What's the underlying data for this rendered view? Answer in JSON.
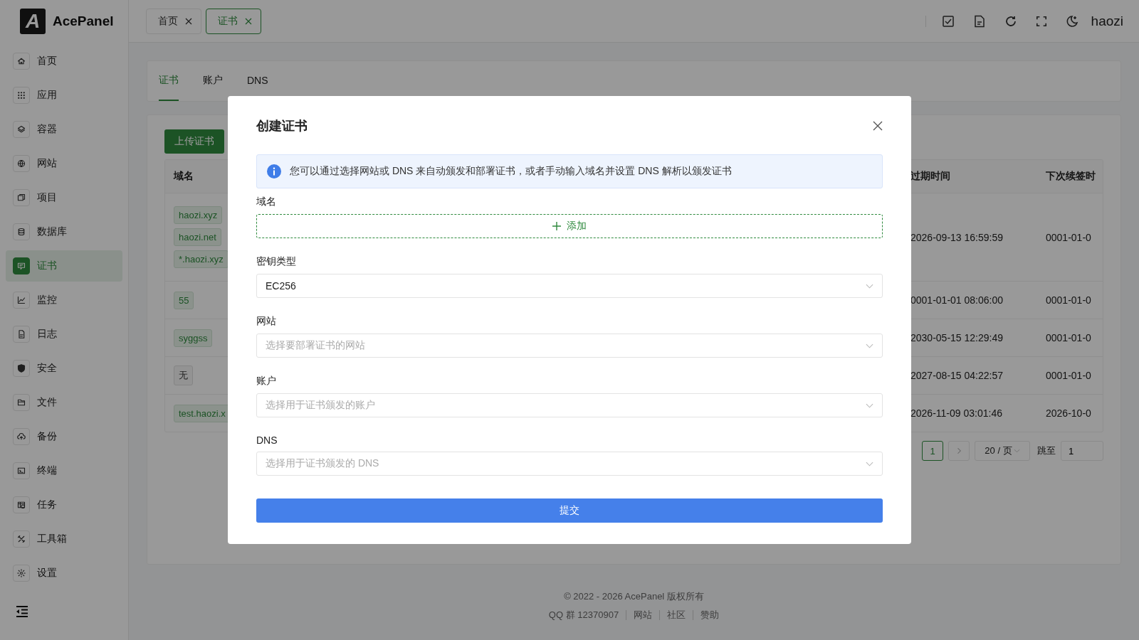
{
  "app": {
    "logo_mark": "A",
    "name": "AcePanel"
  },
  "sidebar": {
    "items": [
      {
        "label": "首页",
        "selected": false
      },
      {
        "label": "应用",
        "selected": false
      },
      {
        "label": "容器",
        "selected": false
      },
      {
        "label": "网站",
        "selected": false
      },
      {
        "label": "项目",
        "selected": false
      },
      {
        "label": "数据库",
        "selected": false
      },
      {
        "label": "证书",
        "selected": true
      },
      {
        "label": "监控",
        "selected": false
      },
      {
        "label": "日志",
        "selected": false
      },
      {
        "label": "安全",
        "selected": false
      },
      {
        "label": "文件",
        "selected": false
      },
      {
        "label": "备份",
        "selected": false
      },
      {
        "label": "终端",
        "selected": false
      },
      {
        "label": "任务",
        "selected": false
      },
      {
        "label": "工具箱",
        "selected": false
      },
      {
        "label": "设置",
        "selected": false
      }
    ]
  },
  "header": {
    "tabs": [
      {
        "label": "首页",
        "selected": false
      },
      {
        "label": "证书",
        "selected": true
      }
    ],
    "user": "haozi"
  },
  "page_tabs": [
    {
      "label": "证书",
      "selected": true
    },
    {
      "label": "账户",
      "selected": false
    },
    {
      "label": "DNS",
      "selected": false
    }
  ],
  "upload_button": "上传证书",
  "table": {
    "columns": [
      "域名",
      "过期时间",
      "下次续签时"
    ],
    "rows": [
      {
        "domains": [
          {
            "text": "haozi.xyz",
            "kind": "domain"
          },
          {
            "text": "haozi.net",
            "kind": "domain"
          },
          {
            "text": "*.haozi.xyz",
            "kind": "domain"
          }
        ],
        "expires": "2026-09-13 16:59:59",
        "next_renewal": "0001-01-0"
      },
      {
        "domains": [
          {
            "text": "55",
            "kind": "domain"
          }
        ],
        "expires": "0001-01-01 08:06:00",
        "next_renewal": "0001-01-0"
      },
      {
        "domains": [
          {
            "text": "syggss",
            "kind": "domain"
          }
        ],
        "expires": "2030-05-15 12:29:49",
        "next_renewal": "0001-01-0"
      },
      {
        "domains": [
          {
            "text": "无",
            "kind": "none"
          }
        ],
        "expires": "2027-08-15 04:22:57",
        "next_renewal": "0001-01-0"
      },
      {
        "domains": [
          {
            "text": "test.haozi.x",
            "kind": "domain"
          }
        ],
        "expires": "2026-11-09 03:01:46",
        "next_renewal": "2026-10-0"
      }
    ]
  },
  "pagination": {
    "page": "1",
    "page_size": "20 / 页",
    "jump_label": "跳至",
    "jump_value": "1"
  },
  "footer": {
    "copyright": "© 2022 - 2026 AcePanel 版权所有",
    "links": [
      "QQ 群 12370907",
      "网站",
      "社区",
      "赞助"
    ]
  },
  "modal": {
    "title": "创建证书",
    "alert": "您可以通过选择网站或 DNS 来自动颁发和部署证书，或者手动输入域名并设置 DNS 解析以颁发证书",
    "fields": [
      {
        "label": "域名",
        "kind": "add",
        "button": "添加"
      },
      {
        "label": "密钥类型",
        "kind": "select",
        "value": "EC256"
      },
      {
        "label": "网站",
        "kind": "select",
        "placeholder": "选择要部署证书的网站"
      },
      {
        "label": "账户",
        "kind": "select",
        "placeholder": "选择用于证书颁发的账户"
      },
      {
        "label": "DNS",
        "kind": "select",
        "placeholder": "选择用于证书颁发的 DNS"
      }
    ],
    "submit": "提交"
  }
}
